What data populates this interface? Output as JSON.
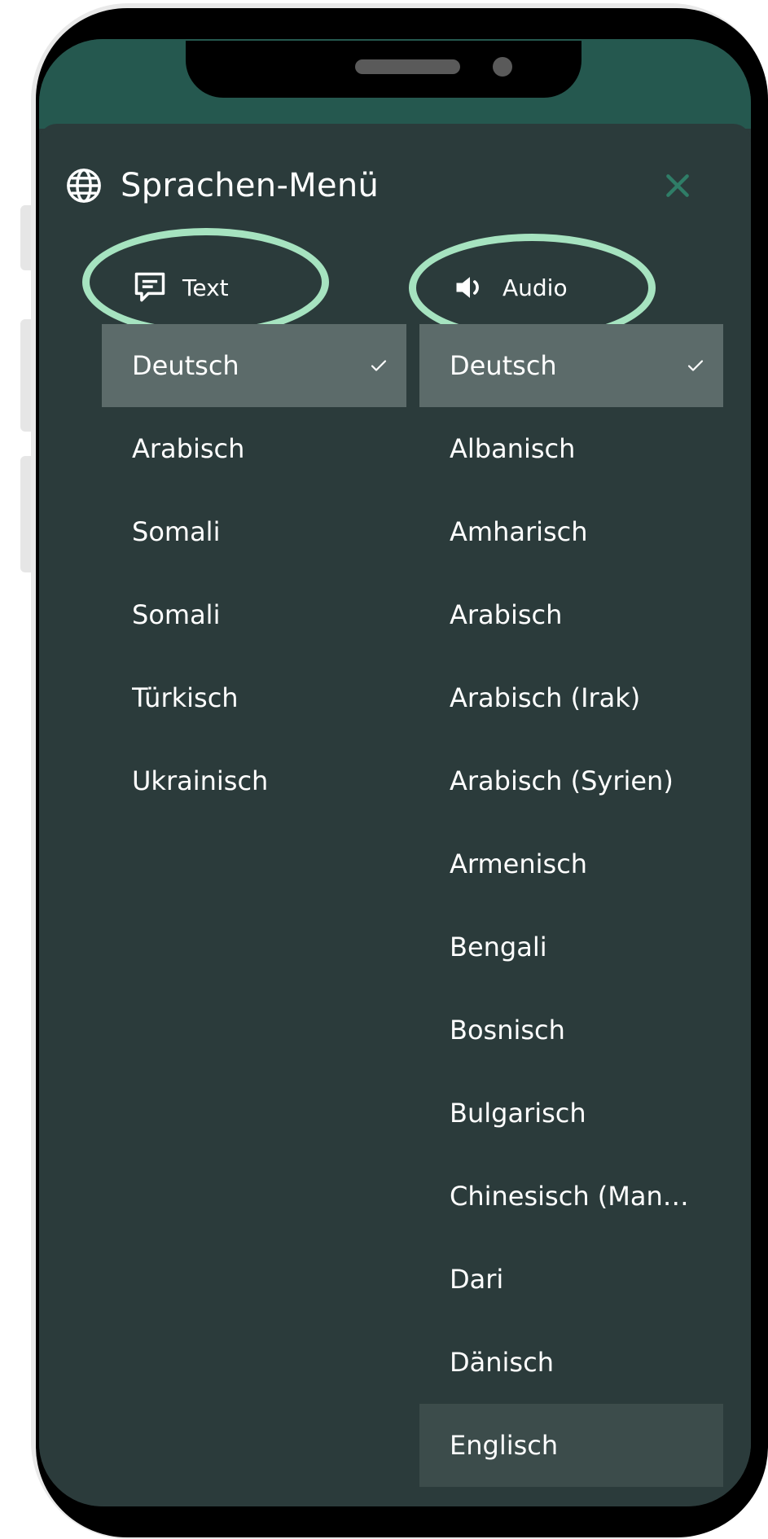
{
  "menu": {
    "title": "Sprachen-Menü",
    "icon": "globe-icon",
    "close_icon": "close-icon"
  },
  "columns": {
    "text": {
      "label": "Text",
      "icon": "chat-bubble-icon",
      "items": [
        {
          "label": "Deutsch",
          "selected": true
        },
        {
          "label": "Arabisch"
        },
        {
          "label": "Somali"
        },
        {
          "label": "Somali"
        },
        {
          "label": "Türkisch"
        },
        {
          "label": "Ukrainisch"
        }
      ]
    },
    "audio": {
      "label": "Audio",
      "icon": "speaker-icon",
      "items": [
        {
          "label": "Deutsch",
          "selected": true
        },
        {
          "label": "Albanisch"
        },
        {
          "label": "Amharisch"
        },
        {
          "label": "Arabisch"
        },
        {
          "label": "Arabisch (Irak)"
        },
        {
          "label": "Arabisch (Syrien)"
        },
        {
          "label": "Armenisch"
        },
        {
          "label": "Bengali"
        },
        {
          "label": "Bosnisch"
        },
        {
          "label": "Bulgarisch"
        },
        {
          "label": "Chinesisch (Man…"
        },
        {
          "label": "Dari"
        },
        {
          "label": "Dänisch"
        },
        {
          "label": "Englisch",
          "hovered": true
        }
      ]
    }
  },
  "colors": {
    "panel": "#2b3b3b",
    "header_band": "#25584f",
    "selected_row": "#5c6b6a",
    "hover_row": "#3c4c4b",
    "annotation_ring": "#a6e3c0",
    "close_icon": "#2f7d67"
  }
}
